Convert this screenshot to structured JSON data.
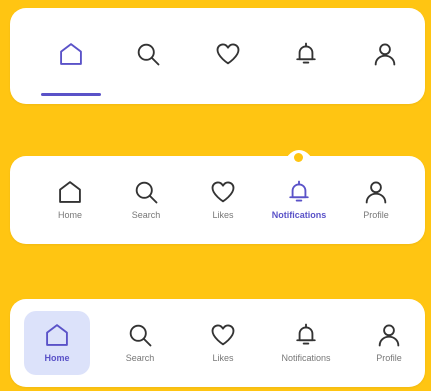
{
  "colors": {
    "background": "#FFC512",
    "bar": "#FFFFFF",
    "accent": "#5A52C8",
    "icon_inactive": "#333333",
    "label_inactive": "#777777",
    "active_pill": "#DCE2FA"
  },
  "bar1": {
    "active": "home",
    "items": [
      {
        "icon": "home-icon"
      },
      {
        "icon": "search-icon"
      },
      {
        "icon": "heart-icon"
      },
      {
        "icon": "bell-icon"
      },
      {
        "icon": "profile-icon"
      }
    ]
  },
  "bar2": {
    "active": "notifications",
    "items": [
      {
        "icon": "home-icon",
        "label": "Home"
      },
      {
        "icon": "search-icon",
        "label": "Search"
      },
      {
        "icon": "heart-icon",
        "label": "Likes"
      },
      {
        "icon": "bell-icon",
        "label": "Notifications"
      },
      {
        "icon": "profile-icon",
        "label": "Profile"
      }
    ]
  },
  "bar3": {
    "active": "home",
    "items": [
      {
        "icon": "home-icon",
        "label": "Home"
      },
      {
        "icon": "search-icon",
        "label": "Search"
      },
      {
        "icon": "heart-icon",
        "label": "Likes"
      },
      {
        "icon": "bell-icon",
        "label": "Notifications"
      },
      {
        "icon": "profile-icon",
        "label": "Profile"
      }
    ]
  }
}
